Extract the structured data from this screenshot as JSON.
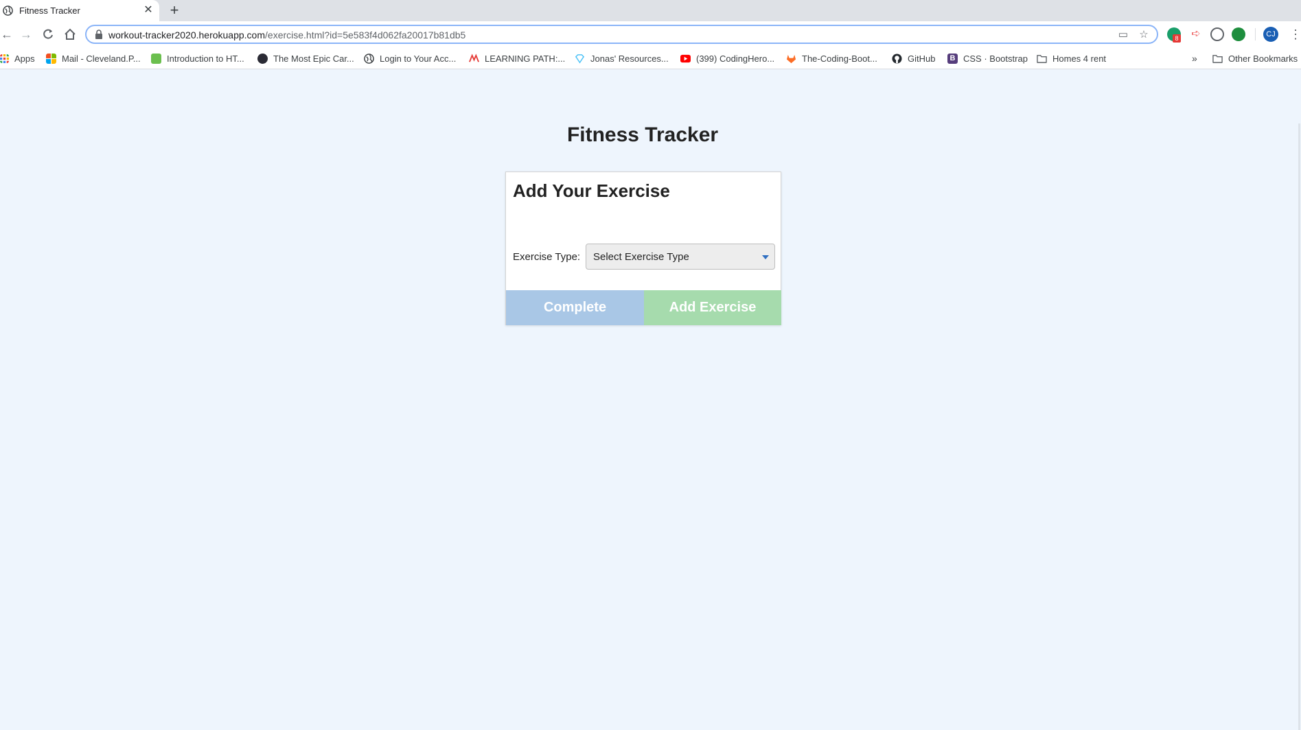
{
  "browser": {
    "tab_title": "Fitness Tracker",
    "tab_close": "✕",
    "new_tab": "+",
    "url_host": "workout-tracker2020.herokuapp.com",
    "url_path": "/exercise.html?id=5e583f4d062fa20017b81db5",
    "profile_initials": "CJ",
    "extension_badge": "8",
    "bookmarks": [
      {
        "label": "Apps",
        "icon": "apps-grid-icon",
        "color": "#e94235"
      },
      {
        "label": "Mail - Cleveland.P...",
        "icon": "microsoft-icon",
        "color": "#f25022"
      },
      {
        "label": "Introduction to HT...",
        "icon": "w3-icon",
        "color": "#6bbf4e"
      },
      {
        "label": "The Most Epic Car...",
        "icon": "dark-circle-icon",
        "color": "#2b2b35"
      },
      {
        "label": "Login to Your Acc...",
        "icon": "globe-icon",
        "color": "#3c4043"
      },
      {
        "label": "LEARNING PATH:...",
        "icon": "red-wave-icon",
        "color": "#e53935"
      },
      {
        "label": "Jonas' Resources...",
        "icon": "diamond-icon",
        "color": "#4fc3f7"
      },
      {
        "label": "(399) CodingHero...",
        "icon": "youtube-icon",
        "color": "#ff0000"
      },
      {
        "label": "The-Coding-Boot...",
        "icon": "gitlab-icon",
        "color": "#fc6d26"
      },
      {
        "label": "GitHub",
        "icon": "github-icon",
        "color": "#24292e"
      },
      {
        "label": "CSS · Bootstrap",
        "icon": "bootstrap-icon",
        "color": "#563d7c"
      },
      {
        "label": "Homes 4 rent",
        "icon": "folder-icon",
        "color": "#5f6368"
      }
    ],
    "overflow": "»",
    "other_bookmarks": "Other Bookmarks"
  },
  "page": {
    "title": "Fitness Tracker",
    "card_title": "Add Your Exercise",
    "exercise_type_label": "Exercise Type:",
    "exercise_type_selected": "Select Exercise Type",
    "complete_label": "Complete",
    "add_exercise_label": "Add Exercise"
  },
  "colors": {
    "background": "#eef5fd",
    "complete_button": "#a9c7e6",
    "add_button": "#a6dbad",
    "select_arrow": "#2f6fc1"
  }
}
